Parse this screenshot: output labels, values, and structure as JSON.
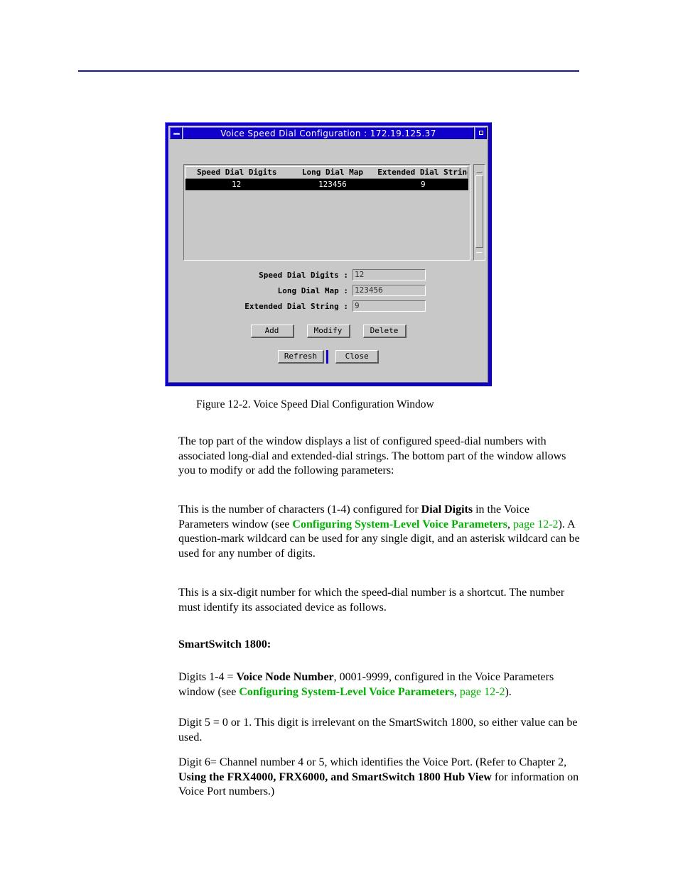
{
  "page": {
    "rule_color": "#14179e"
  },
  "window": {
    "title": "Voice Speed Dial Configuration : 172.19.125.37",
    "titlebar_color": "#1100cc",
    "face_color": "#c8c8c8",
    "minimize_icon": "minimize-icon",
    "maximize_icon": "maximize-icon",
    "list": {
      "columns": [
        "Speed Dial Digits",
        "Long Dial Map",
        "Extended Dial String"
      ],
      "rows": [
        {
          "speed_dial_digits": "12",
          "long_dial_map": "123456",
          "extended_dial_string": "9",
          "selected": true
        }
      ],
      "scrollbar": {
        "up_icon": "scroll-up-arrow-icon",
        "down_icon": "scroll-down-arrow-icon"
      }
    },
    "fields": [
      {
        "label": "Speed Dial Digits :",
        "value": "12"
      },
      {
        "label": "Long Dial Map :",
        "value": "123456"
      },
      {
        "label": "Extended Dial String :",
        "value": "9"
      }
    ],
    "buttons_row1": [
      {
        "label": "Add"
      },
      {
        "label": "Modify"
      },
      {
        "label": "Delete"
      }
    ],
    "buttons_row2": [
      {
        "label": "Refresh"
      },
      {
        "label": "Close",
        "is_default": true
      }
    ]
  },
  "document": {
    "figure_caption": "Figure 12-2.  Voice Speed Dial Configuration Window",
    "p1": {
      "text": "The top part of the window displays a list of configured speed-dial numbers with associated long-dial and extended-dial strings. The bottom part of the window allows you to modify or add the following parameters:"
    },
    "p2": {
      "t1": "This is the number of characters (1-4) configured for ",
      "b1": "Dial Digits",
      "t2": " in the Voice Parameters window (see ",
      "link1": "Configuring System-Level Voice Parameters",
      "t3": ", ",
      "link2": "page 12-2",
      "t4": "). A question-mark wildcard can be used for any single digit, and an asterisk wildcard can be used for any number of digits."
    },
    "p3": {
      "text": "This is a six-digit number for which the speed-dial number is a shortcut. The number must identify its associated device as follows."
    },
    "p4": {
      "heading": "SmartSwitch 1800:"
    },
    "p5": {
      "t1": "Digits 1-4 = ",
      "b1": "Voice Node Number",
      "t2": ", 0001-9999, configured in the Voice Parameters window (see ",
      "link1": "Configuring System-Level Voice Parameters",
      "t3": ", ",
      "link2": "page 12-2",
      "t4": ")."
    },
    "p6": {
      "text": "Digit 5 = 0 or 1. This digit is irrelevant on the SmartSwitch 1800, so either value can be used."
    },
    "p7": {
      "t1": "Digit 6= Channel number 4 or 5, which identifies the Voice Port. (Refer to Chapter  2, ",
      "b1": "Using the FRX4000, FRX6000, and SmartSwitch 1800 Hub View",
      "t2": " for information on Voice Port numbers.)"
    }
  }
}
